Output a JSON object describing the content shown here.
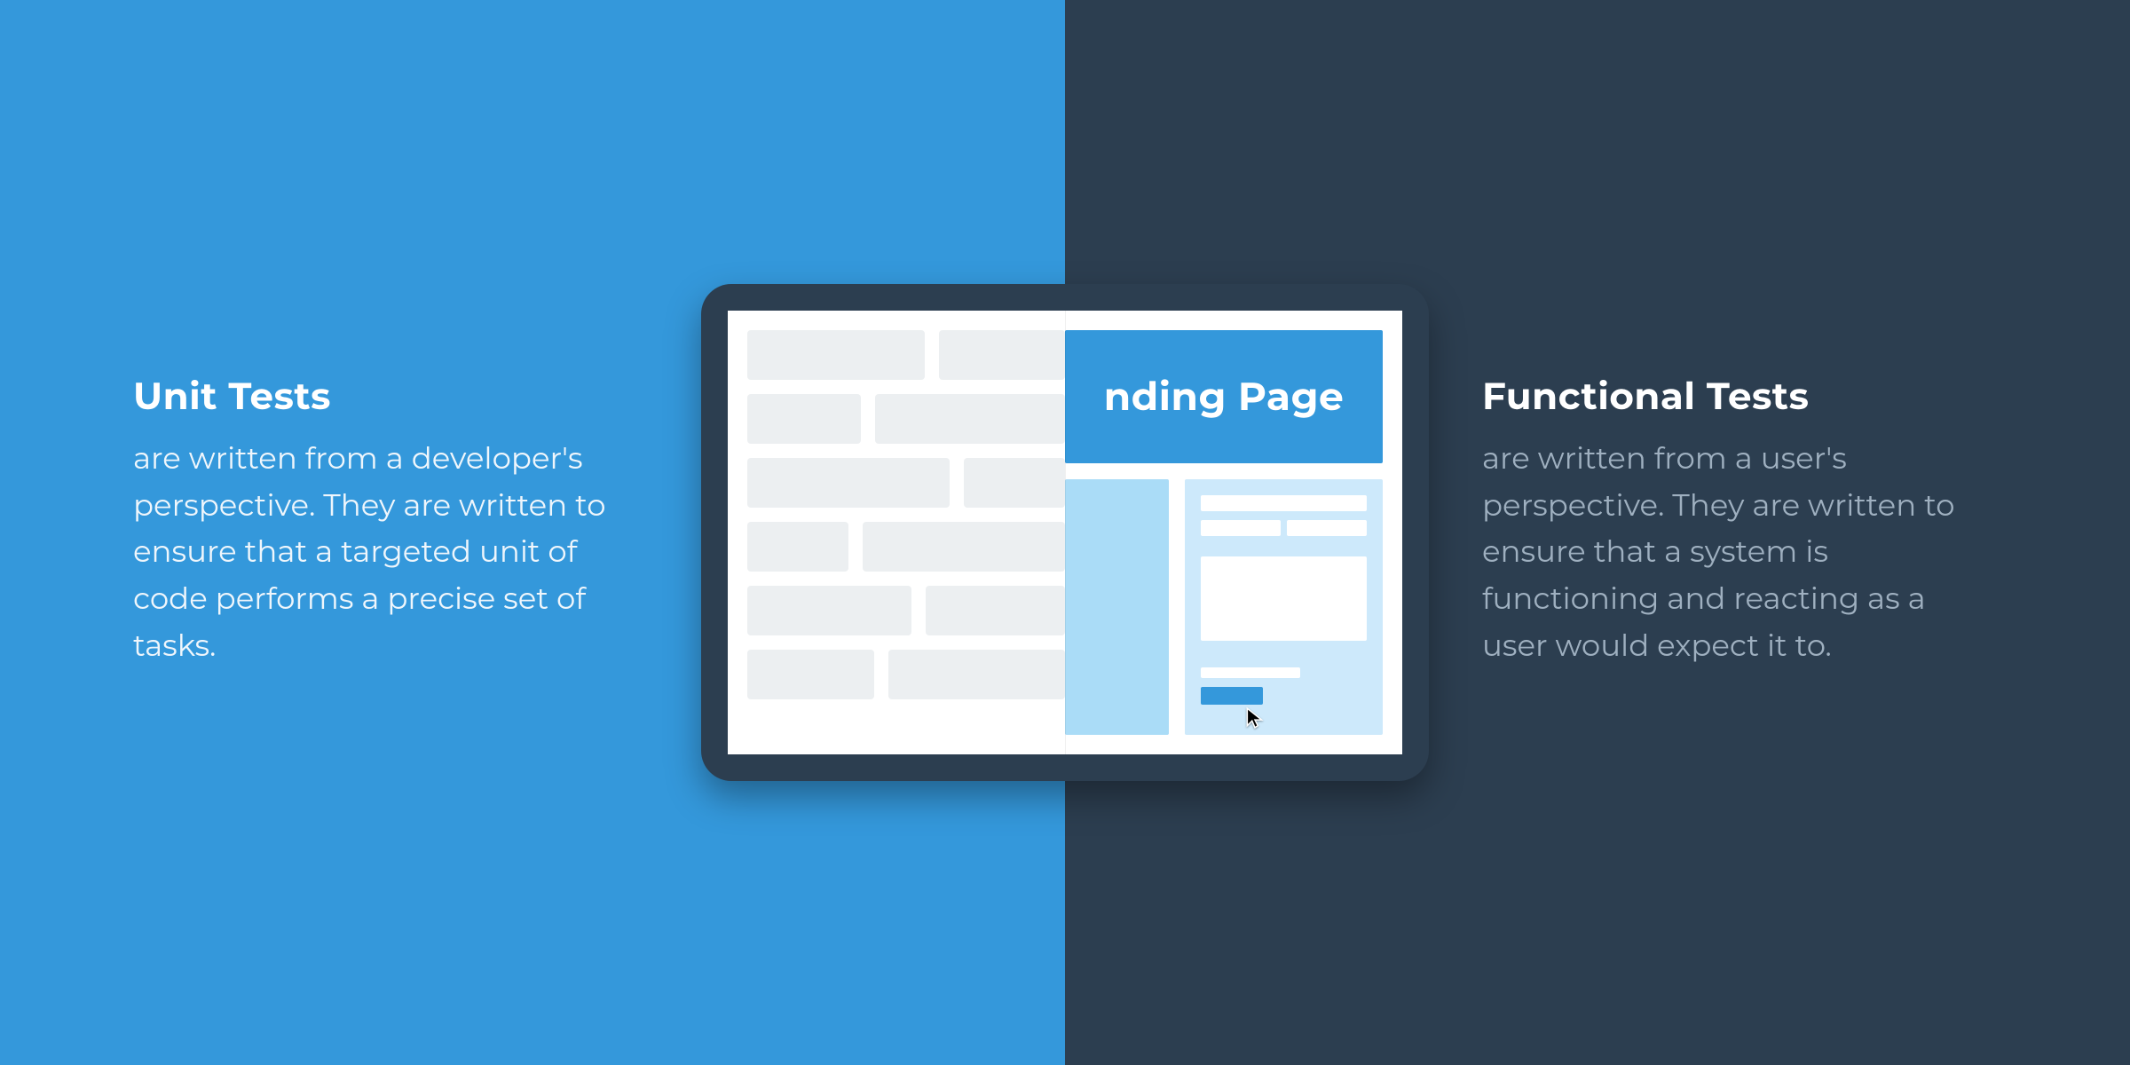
{
  "colors": {
    "blue": "#3498db",
    "dark": "#2c3e50",
    "lightBlue1": "#aadcf7",
    "lightBlue2": "#cde9fb",
    "wireframe": "#eceff1",
    "white": "#ffffff"
  },
  "left": {
    "title": "Unit Tests",
    "body": "are written from a developer's perspective. They are written to ensure that a targeted unit of code performs a precise set of tasks."
  },
  "right": {
    "title": "Functional Tests",
    "body": "are written from a user's perspective. They are written to ensure that a system is functioning and reacting as a user would expect it to."
  },
  "device": {
    "heroText": "nding Page"
  }
}
